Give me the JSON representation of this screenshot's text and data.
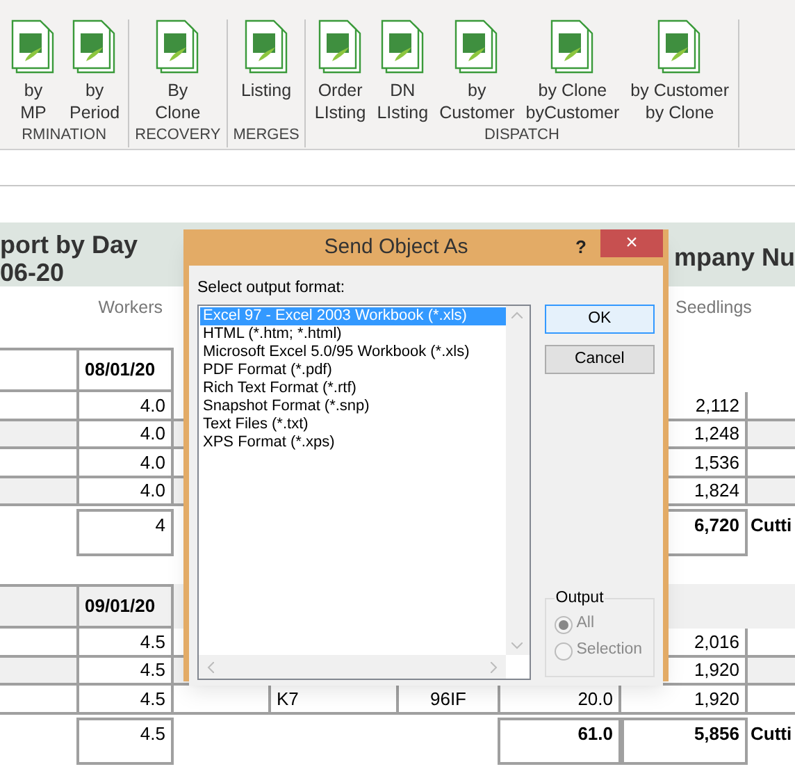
{
  "ribbon": {
    "groups": [
      {
        "label": "RMINATION",
        "buttons": [
          {
            "lines": [
              "by",
              "MP"
            ]
          },
          {
            "lines": [
              "by",
              "Period"
            ]
          }
        ]
      },
      {
        "label": "RECOVERY",
        "buttons": [
          {
            "lines": [
              "By",
              "Clone"
            ]
          }
        ]
      },
      {
        "label": "MERGES",
        "buttons": [
          {
            "lines": [
              "Listing"
            ]
          }
        ]
      },
      {
        "label": "DISPATCH",
        "buttons": [
          {
            "lines": [
              "Order",
              "LIsting"
            ]
          },
          {
            "lines": [
              "DN",
              "LIsting"
            ]
          },
          {
            "lines": [
              "by",
              "Customer"
            ]
          },
          {
            "lines": [
              "by Clone",
              "byCustomer"
            ]
          },
          {
            "lines": [
              "by Customer",
              "by Clone"
            ]
          }
        ]
      }
    ]
  },
  "report": {
    "title_left": [
      "port by Day",
      "06-20"
    ],
    "title_right": "mpany Nu",
    "workers_heading": "Workers",
    "seedlings_heading": "Seedlings",
    "groups": [
      {
        "date": "08/01/20",
        "shaded": false,
        "rows": [
          {
            "workers": "4.0",
            "seedlings": "2,112"
          },
          {
            "workers": "4.0",
            "seedlings": "1,248"
          },
          {
            "workers": "4.0",
            "seedlings": "1,536"
          },
          {
            "workers": "4.0",
            "seedlings": "1,824"
          }
        ],
        "total": {
          "workers": "4",
          "seedlings": "6,720",
          "column_8": "Cutti"
        }
      },
      {
        "date": "09/01/20",
        "shaded": true,
        "rows": [
          {
            "workers": "4.5",
            "seedlings": "2,016"
          },
          {
            "workers": "4.5",
            "seedlings": "1,920"
          },
          {
            "workers": "4.5",
            "column_4": "K7",
            "column_5": "96IF",
            "column_6": "20.0",
            "seedlings": "1,920"
          }
        ],
        "total": {
          "workers": "4.5",
          "column_6": "61.0",
          "seedlings": "5,856",
          "column_8": "Cutti"
        }
      }
    ]
  },
  "dialog": {
    "title": "Send Object As",
    "help": "?",
    "close": "×",
    "list_label": "Select output format:",
    "formats": [
      {
        "label": "Excel 97 - Excel 2003 Workbook (*.xls)",
        "selected": true
      },
      {
        "label": "HTML (*.htm; *.html)",
        "selected": false
      },
      {
        "label": "Microsoft Excel 5.0/95 Workbook (*.xls)",
        "selected": false
      },
      {
        "label": "PDF Format (*.pdf)",
        "selected": false
      },
      {
        "label": "Rich Text Format (*.rtf)",
        "selected": false
      },
      {
        "label": "Snapshot Format (*.snp)",
        "selected": false
      },
      {
        "label": "Text Files (*.txt)",
        "selected": false
      },
      {
        "label": "XPS Format (*.xps)",
        "selected": false
      }
    ],
    "buttons": [
      {
        "label": "OK",
        "default": true
      },
      {
        "label": "Cancel",
        "default": false
      }
    ],
    "output": {
      "legend": "Output",
      "options": [
        {
          "label": "All",
          "selected": true,
          "disabled": true
        },
        {
          "label": "Selection",
          "selected": false,
          "disabled": true
        }
      ]
    }
  }
}
